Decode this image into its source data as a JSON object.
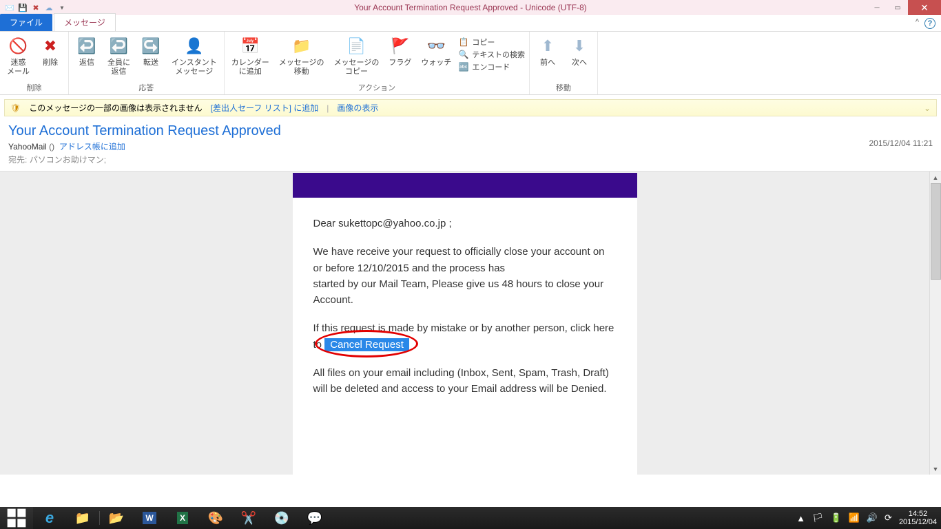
{
  "titlebar": {
    "title": "Your Account Termination Request Approved - Unicode (UTF-8)"
  },
  "tabs": {
    "file": "ファイル",
    "message": "メッセージ"
  },
  "ribbon": {
    "groups": {
      "delete": {
        "label": "削除",
        "spam": "迷惑\nメール",
        "del": "削除"
      },
      "reply": {
        "label": "応答",
        "reply": "返信",
        "replyall": "全員に\n返信",
        "forward": "転送",
        "im": "インスタント\nメッセージ"
      },
      "actions": {
        "label": "アクション",
        "calendar": "カレンダー\nに追加",
        "move": "メッセージの\n移動",
        "copymsg": "メッセージの\nコピー",
        "flag": "フラグ",
        "watch": "ウォッチ",
        "copy": "コピー",
        "findtext": "テキストの検索",
        "encode": "エンコード"
      },
      "move": {
        "label": "移動",
        "prev": "前へ",
        "next": "次へ"
      }
    }
  },
  "infobar": {
    "text": "このメッセージの一部の画像は表示されません",
    "link1": "[差出人セーフ リスト] に追加",
    "link2": "画像の表示"
  },
  "header": {
    "subject": "Your Account Termination Request Approved",
    "from_name": "YahooMail",
    "from_paren": "()",
    "add_contact": "アドレス帳に追加",
    "to_label": "宛先:",
    "to_value": "パソコンお助けマン;",
    "date": "2015/12/04 11:21"
  },
  "body": {
    "greeting": "Dear sukettopc@yahoo.co.jp ;",
    "p1": " We have receive your request to officially close your account on or before 12/10/2015 and the process has\n started by our Mail Team, Please give us 48 hours to close your Account.",
    "p2a": " If this request is made by mistake or by another person, click here to ",
    "cancel": "Cancel Request",
    "p3": " All files on your email including (Inbox, Sent, Spam, Trash, Draft)\n will be deleted and access to your Email address will be Denied."
  },
  "taskbar": {
    "time": "14:52",
    "date": "2015/12/04"
  }
}
